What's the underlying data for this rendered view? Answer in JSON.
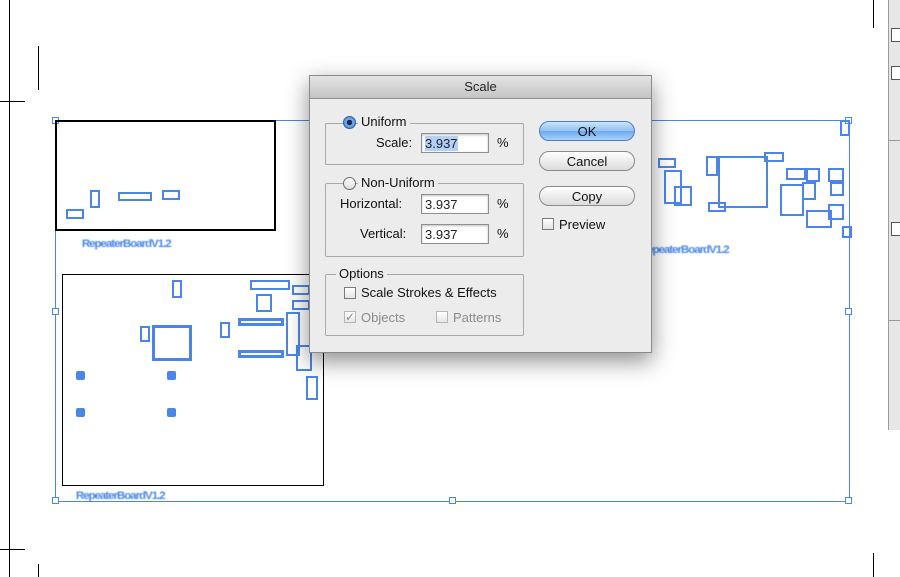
{
  "dialog": {
    "title": "Scale",
    "uniform": {
      "label": "Uniform",
      "selected": true,
      "scale_label": "Scale:",
      "scale_value": "3.937",
      "percent": "%"
    },
    "non_uniform": {
      "label": "Non-Uniform",
      "selected": false,
      "horizontal_label": "Horizontal:",
      "horizontal_value": "3.937",
      "vertical_label": "Vertical:",
      "vertical_value": "3.937",
      "percent": "%"
    },
    "options": {
      "label": "Options",
      "scale_strokes_label": "Scale Strokes & Effects",
      "scale_strokes_checked": false,
      "objects_label": "Objects",
      "objects_checked": true,
      "patterns_label": "Patterns",
      "patterns_checked": false
    },
    "buttons": {
      "ok": "OK",
      "cancel": "Cancel",
      "copy": "Copy"
    },
    "preview": {
      "label": "Preview",
      "checked": false
    }
  },
  "canvas": {
    "labels": {
      "top_left_board": "RepeaterBoardV1.2",
      "bottom_left_board": "RepeaterBoardV1.2",
      "right_board": "RepeaterBoardV1.2"
    },
    "accent_color": "#4a86e8"
  }
}
